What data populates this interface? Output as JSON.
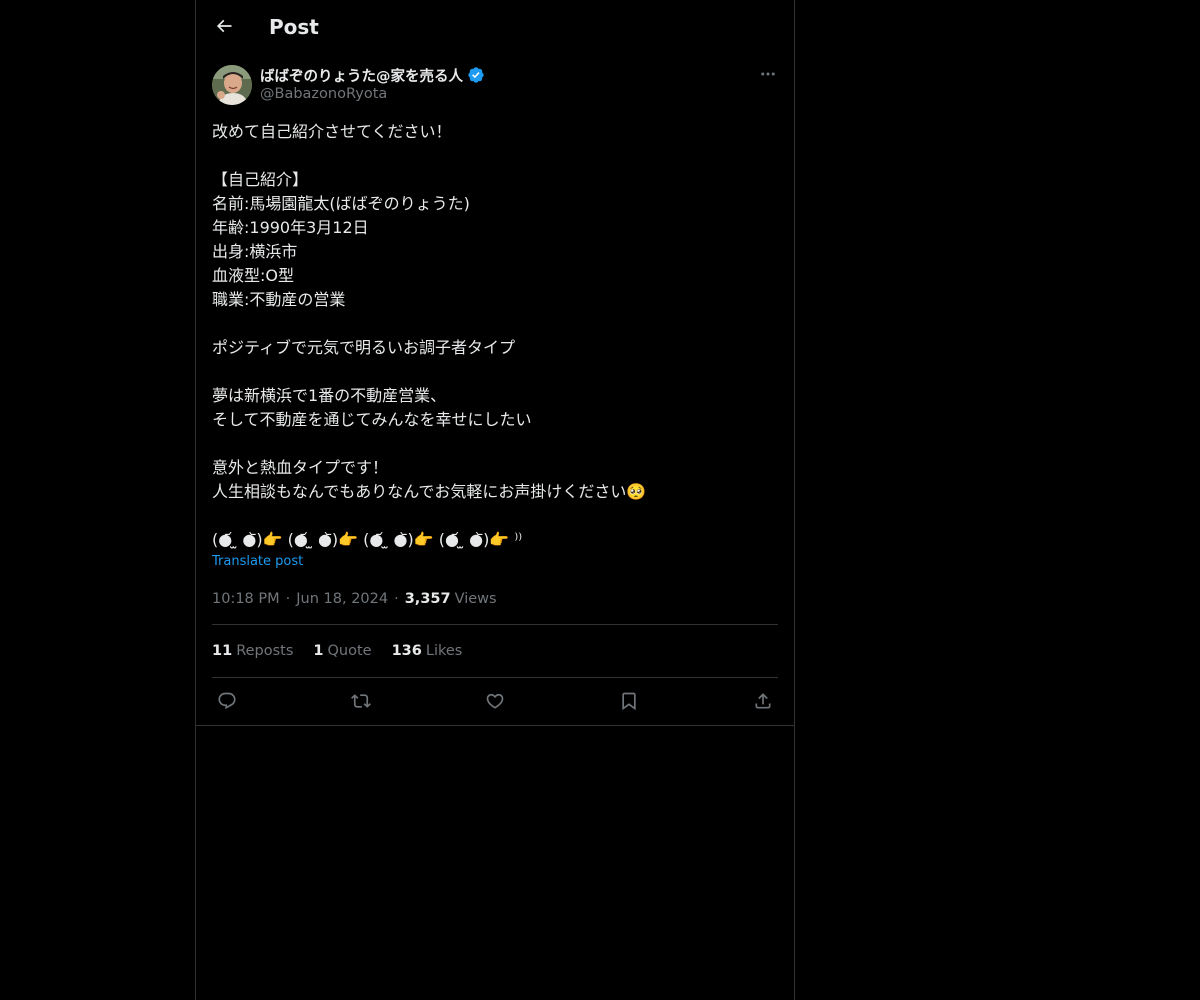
{
  "header": {
    "title": "Post",
    "back_icon": "arrow-left-icon"
  },
  "author": {
    "display_name": "ばばぞのりょうた@家を売る人",
    "handle": "@BabazonoRyota",
    "verified_icon": "verified-badge-icon",
    "verified_color": "#1d9bf0"
  },
  "post": {
    "text": "改めて自己紹介させてください！\n\n【自己紹介】\n名前:馬場園龍太(ばばぞのりょうた)\n年齢:1990年3月12日\n出身:横浜市\n血液型:O型\n職業:不動産の営業\n\nポジティブで元気で明るいお調子者タイプ\n\n夢は新横浜で1番の不動産営業、\nそして不動産を通じてみんなを幸せにしたい\n\n意外と熱血タイプです！\n人生相談もなんでもありなんでお気軽にお声掛けください🥺\n\n(●᷄ ̫ ●᷅)👉 (●᷄ ̫ ●᷅)👉 (●᷄ ̫ ●᷅)👉 (●᷄ ̫ ●᷅)👉 ⁾⁾",
    "translate_label": "Translate post",
    "time": "10:18 PM",
    "separator": "·",
    "date": "Jun 18, 2024",
    "views_count": "3,357",
    "views_label": "Views"
  },
  "stats": {
    "reposts_count": "11",
    "reposts_label": "Reposts",
    "quotes_count": "1",
    "quotes_label": "Quote",
    "likes_count": "136",
    "likes_label": "Likes"
  },
  "actions": {
    "reply_icon": "reply-icon",
    "repost_icon": "repost-icon",
    "like_icon": "heart-icon",
    "bookmark_icon": "bookmark-icon",
    "share_icon": "share-icon"
  },
  "colors": {
    "background": "#000000",
    "text_primary": "#e7e9ea",
    "text_secondary": "#71767b",
    "accent": "#1d9bf0",
    "border": "#2f3336"
  }
}
